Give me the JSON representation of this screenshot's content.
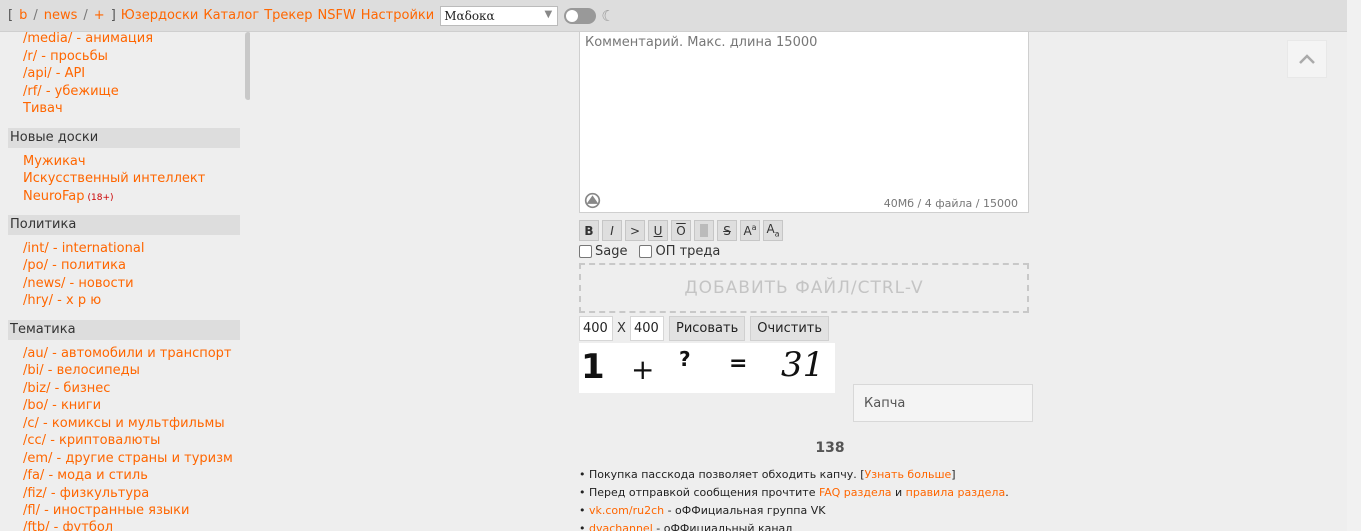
{
  "topbar": {
    "bracket_open": "[",
    "bracket_close": "]",
    "sep": "/",
    "link_b": "b",
    "link_news": "news",
    "link_plus": "+",
    "menu_userboards": "Юзердоски",
    "menu_catalog": "Каталог",
    "menu_tracker": "Трекер",
    "menu_nsfw": "NSFW",
    "menu_settings": "Настройки",
    "style_value": "Мαδокα"
  },
  "sidebar": {
    "top_links": [
      {
        "code": "/media/",
        "name": "анимация"
      },
      {
        "code": "/r/",
        "name": "просьбы"
      },
      {
        "code": "/api/",
        "name": "API"
      },
      {
        "code": "/rf/",
        "name": "убежище"
      },
      {
        "code": "",
        "name": "Тивач"
      }
    ],
    "sections": [
      {
        "title": "Новые доски",
        "items": [
          "Мужикач",
          "Искусственный интеллект",
          "NeuroFap"
        ]
      },
      {
        "title": "Политика",
        "items": []
      },
      {
        "title": "Тематика",
        "items": []
      }
    ],
    "nsfw_badge": "(18+)",
    "politics": [
      {
        "code": "/int/",
        "name": "international"
      },
      {
        "code": "/po/",
        "name": "политика"
      },
      {
        "code": "/news/",
        "name": "новости"
      },
      {
        "code": "/hry/",
        "name": "х р ю"
      }
    ],
    "thematic": [
      {
        "code": "/au/",
        "name": "автомобили и транспорт"
      },
      {
        "code": "/bi/",
        "name": "велосипеды"
      },
      {
        "code": "/biz/",
        "name": "бизнес"
      },
      {
        "code": "/bo/",
        "name": "книги"
      },
      {
        "code": "/c/",
        "name": "комиксы и мультфильмы"
      },
      {
        "code": "/cc/",
        "name": "криптовалюты"
      },
      {
        "code": "/em/",
        "name": "другие страны и туризм"
      },
      {
        "code": "/fa/",
        "name": "мода и стиль"
      },
      {
        "code": "/fiz/",
        "name": "физкультура"
      },
      {
        "code": "/fl/",
        "name": "иностранные языки"
      },
      {
        "code": "/ftb/",
        "name": "футбол"
      }
    ]
  },
  "form": {
    "comment_placeholder": "Комментарий. Макс. длина 15000",
    "limits_info": "40Мб / 4 файла / 15000",
    "markup": [
      "B",
      "I",
      ">",
      "U",
      "O",
      "",
      "S",
      "Aa",
      "Aa"
    ],
    "sage_label": "Sage",
    "op_label": "ОП треда",
    "dropzone_label": "ДОБАВИТЬ ФАЙЛ/CTRL-V",
    "draw_width": "400",
    "draw_x": "X",
    "draw_height": "400",
    "draw_button": "Рисовать",
    "clear_button": "Очистить",
    "captcha_glyphs": [
      "1",
      "+",
      "?",
      "=",
      "31"
    ],
    "captcha_placeholder": "Капча",
    "counter": "138"
  },
  "rules": {
    "bullet": "•",
    "line1_text": "Покупка пасскода позволяет обходить капчу. [",
    "line1_link": "Узнать больше",
    "line1_end": "]",
    "line2_text": "Перед отправкой сообщения прочтите",
    "line2_link1": "FAQ раздела",
    "line2_and": "и",
    "line2_link2": "правила раздела",
    "line2_end": ".",
    "line3_link": "vk.com/ru2ch",
    "line3_text": "- оФФициальная группа VK",
    "line4_link": "dvachannel",
    "line4_text": "- оФФициальный канал"
  },
  "colors": {
    "accent": "#ff6600",
    "background": "#eeeeee"
  }
}
